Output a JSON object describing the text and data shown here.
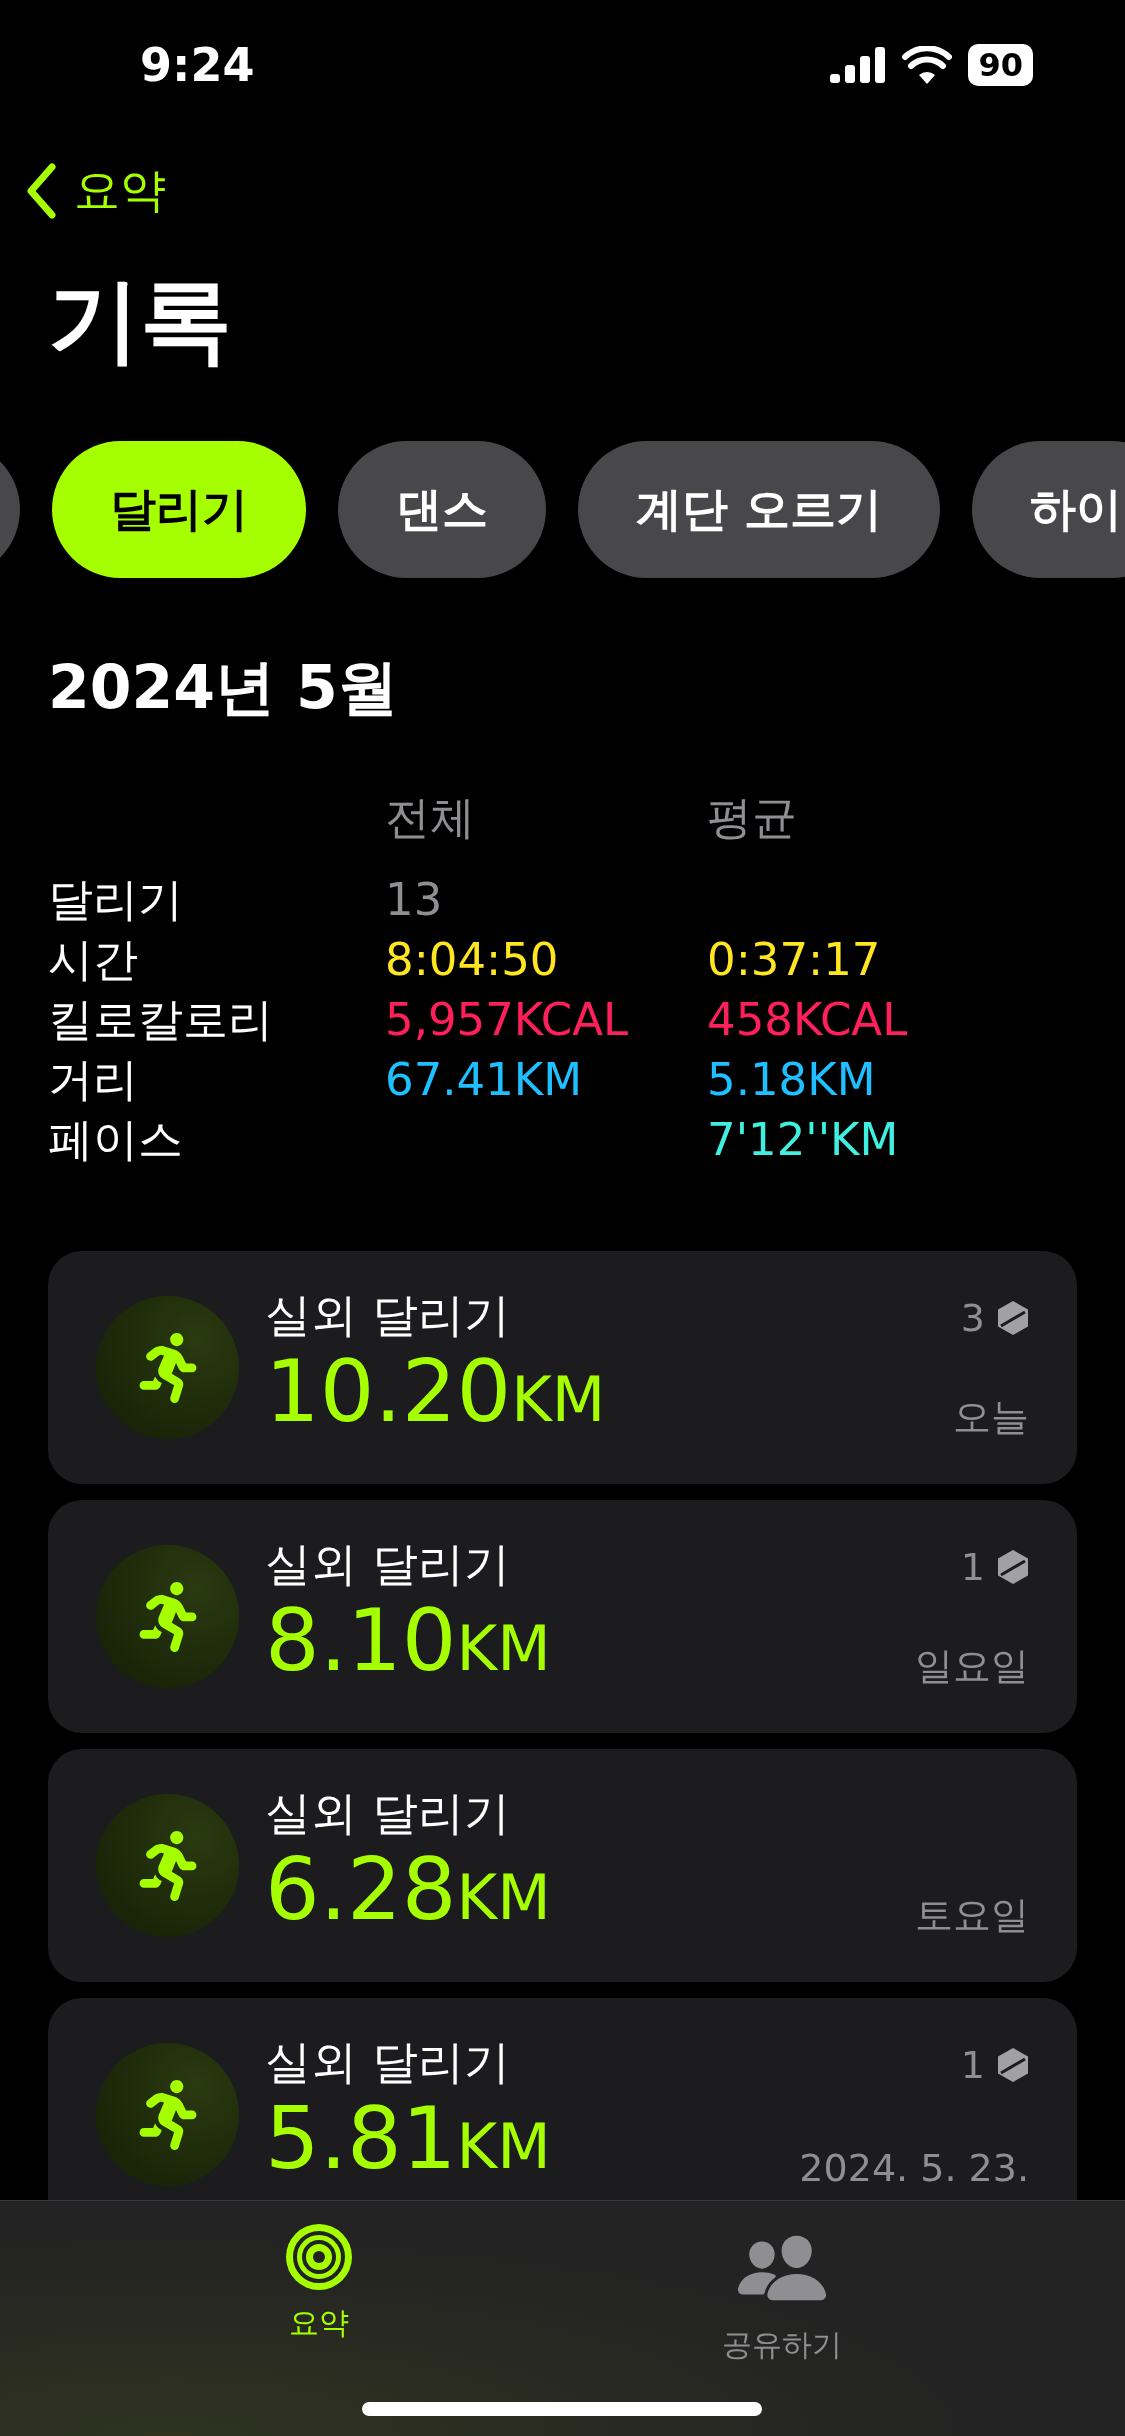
{
  "status_bar": {
    "time": "9:24",
    "battery": "90"
  },
  "nav": {
    "back": "요약",
    "title": "기록"
  },
  "filters": [
    {
      "selected": false
    },
    {
      "label": "달리기",
      "selected": true
    },
    {
      "label": "댄스",
      "selected": false
    },
    {
      "label": "계단 오르기",
      "selected": false
    },
    {
      "label": "하이",
      "selected": false
    }
  ],
  "month": "2024년 5월",
  "stats": {
    "columns": [
      "전체",
      "평균"
    ],
    "rows": [
      {
        "label": "달리기",
        "total": "13",
        "average": "",
        "color": "#8e8e93"
      },
      {
        "label": "시간",
        "total": "8:04:50",
        "average": "0:37:17",
        "color": "#ffe620"
      },
      {
        "label": "킬로칼로리",
        "total": "5,957KCAL",
        "average": "458KCAL",
        "color": "#ff1f5a"
      },
      {
        "label": "거리",
        "total": "67.41KM",
        "average": "5.18KM",
        "color": "#1ec0ff"
      },
      {
        "label": "페이스",
        "total": "",
        "average": "7'12''KM",
        "color": "#3ff0e0"
      }
    ]
  },
  "workouts": [
    {
      "title": "실외 달리기",
      "distance": "10.20",
      "unit": "KM",
      "badge_count": "3",
      "date": "오늘"
    },
    {
      "title": "실외 달리기",
      "distance": "8.10",
      "unit": "KM",
      "badge_count": "1",
      "date": "일요일"
    },
    {
      "title": "실외 달리기",
      "distance": "6.28",
      "unit": "KM",
      "date": "토요일"
    },
    {
      "title": "실외 달리기",
      "distance": "5.81",
      "unit": "KM",
      "badge_count": "1",
      "date": "2024. 5. 23."
    }
  ],
  "tab_bar": [
    {
      "label": "요약",
      "kind": "rings",
      "selected": true
    },
    {
      "label": "공유하기",
      "kind": "people",
      "selected": false
    }
  ]
}
